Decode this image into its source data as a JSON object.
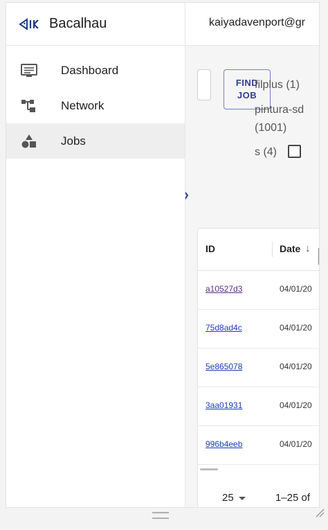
{
  "brand": {
    "name": "Bacalhau",
    "icon": "bacalhau-fish-logo-icon",
    "color": "#1f3a8a"
  },
  "sidebar": {
    "items": [
      {
        "label": "Dashboard",
        "icon": "monitor-icon",
        "active": false
      },
      {
        "label": "Network",
        "icon": "network-tree-icon",
        "active": false
      },
      {
        "label": "Jobs",
        "icon": "shapes-icon",
        "active": true
      }
    ]
  },
  "header": {
    "user_email": "kaiyadavenport@gr"
  },
  "search": {
    "button_label_line1": "FIND",
    "button_label_line2": "JOB"
  },
  "facets": {
    "filplus": "filplus (1)",
    "pintura_line1": "pintura-sd",
    "pintura_line2": "(1001)",
    "s": "s (4)"
  },
  "table": {
    "columns": {
      "id": "ID",
      "date": "Date"
    },
    "sort_icon": "sort-down-icon",
    "rows": [
      {
        "id": "a10527d3",
        "date": "04/01/20",
        "visited": true
      },
      {
        "id": "75d8ad4c",
        "date": "04/01/20",
        "visited": false
      },
      {
        "id": "5e865078",
        "date": "04/01/20",
        "visited": false
      },
      {
        "id": "3aa01931",
        "date": "04/01/20",
        "visited": false
      },
      {
        "id": "996b4eeb",
        "date": "04/01/20",
        "visited": false
      }
    ]
  },
  "pagination": {
    "rows_per_page": "25",
    "range": "1–25 of"
  },
  "colors": {
    "accent": "#2f3f8e",
    "link": "#1a3bb8",
    "visited_link": "#5b2a86",
    "active_nav_bg": "#eeeeef"
  }
}
